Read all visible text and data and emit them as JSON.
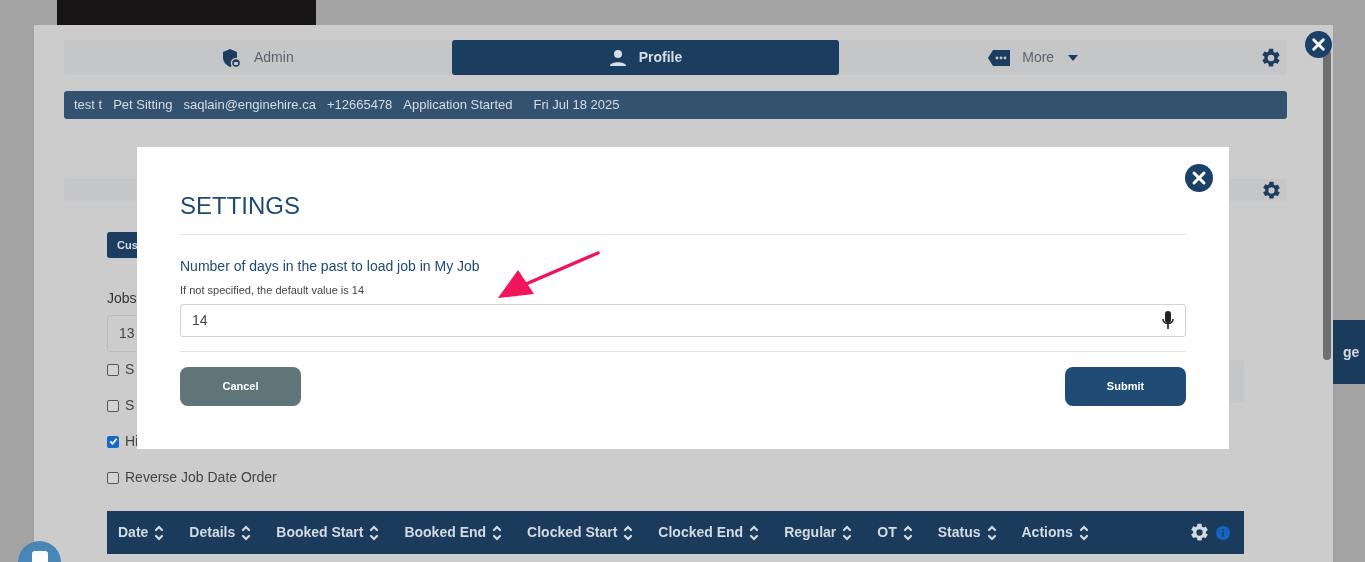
{
  "tabs": [
    {
      "label": "Admin",
      "kind": "shield",
      "selected": false
    },
    {
      "label": "Profile",
      "kind": "person",
      "selected": true
    },
    {
      "label": "More",
      "kind": "tag",
      "selected": false
    }
  ],
  "info_bar": [
    "test t",
    "Pet Sitting",
    "saqlain@enginehire.ca",
    "+12665478",
    "Application Started",
    "Fri Jul 18 2025"
  ],
  "background": {
    "button": "Cus",
    "jobs_label": "Jobs",
    "jobs_field": "13",
    "options": [
      {
        "label": "S",
        "checked": false
      },
      {
        "label": "S",
        "checked": false
      },
      {
        "label": "Hi",
        "checked": true
      },
      {
        "label": "Reverse Job Date Order",
        "checked": false
      }
    ],
    "side_header": "ge"
  },
  "table": {
    "columns": [
      "Date",
      "Details",
      "Booked Start",
      "Booked End",
      "Clocked Start",
      "Clocked End",
      "Regular",
      "OT",
      "Status",
      "Actions"
    ]
  },
  "modal": {
    "title": "SETTINGS",
    "label": "Number of days in the past to load job in My Job",
    "hint": "If not specified, the default value is 14",
    "value": "14",
    "buttons": [
      {
        "label": "Cancel",
        "kind": "secondary"
      },
      {
        "label": "Submit",
        "kind": "primary"
      }
    ]
  }
}
